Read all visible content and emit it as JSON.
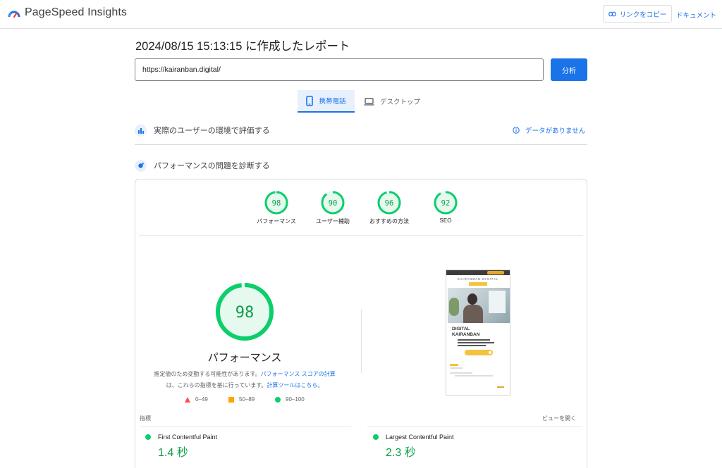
{
  "header": {
    "logo_text": "PageSpeed Insights",
    "copy_link_label": "リンクをコピー",
    "docs_label": "ドキュメント"
  },
  "report": {
    "title": "2024/08/15 15:13:15 に作成したレポート"
  },
  "search": {
    "url_value": "https://kairanban.digital/",
    "analyze_label": "分析"
  },
  "tabs": [
    {
      "label": "携帯電話",
      "selected": true
    },
    {
      "label": "デスクトップ",
      "selected": false
    }
  ],
  "crux": {
    "title": "実際のユーザーの環境で評価する",
    "no_data_label": "データがありません"
  },
  "diagnose": {
    "title": "パフォーマンスの問題を診断する"
  },
  "scores": [
    {
      "label": "パフォーマンス",
      "value": 98
    },
    {
      "label": "ユーザー補助",
      "value": 90
    },
    {
      "label": "おすすめの方法",
      "value": 96
    },
    {
      "label": "SEO",
      "value": 92
    }
  ],
  "performance": {
    "score": 98,
    "label": "パフォーマンス",
    "desc_part1": "推定値のため変動する可能性があります。",
    "desc_link1": "パフォーマンス スコアの計算",
    "desc_part2": "は、これらの指標を基に行っています。",
    "desc_link2": "計算ツールはこちら。"
  },
  "legend": [
    {
      "range": "0–49",
      "color": "#ff4e42",
      "shape": "triangle"
    },
    {
      "range": "50–89",
      "color": "#ffa400",
      "shape": "square"
    },
    {
      "range": "90–100",
      "color": "#0cce6b",
      "shape": "circle"
    }
  ],
  "metrics": {
    "section_label": "指標",
    "view_label": "ビューを開く",
    "items": [
      {
        "name": "First Contentful Paint",
        "value": "1.4 秒"
      },
      {
        "name": "Largest Contentful Paint",
        "value": "2.3 秒"
      }
    ]
  },
  "screenshot": {
    "brand": "KAIRANBAN DIGITAL",
    "heading_1": "DIGITAL",
    "heading_2": "KAIRANBAN"
  },
  "colors": {
    "accent": "#1a73e8",
    "pass": "#0cce6b",
    "pass_text": "#0c9d48",
    "pass_fill": "#e6f9ee"
  }
}
